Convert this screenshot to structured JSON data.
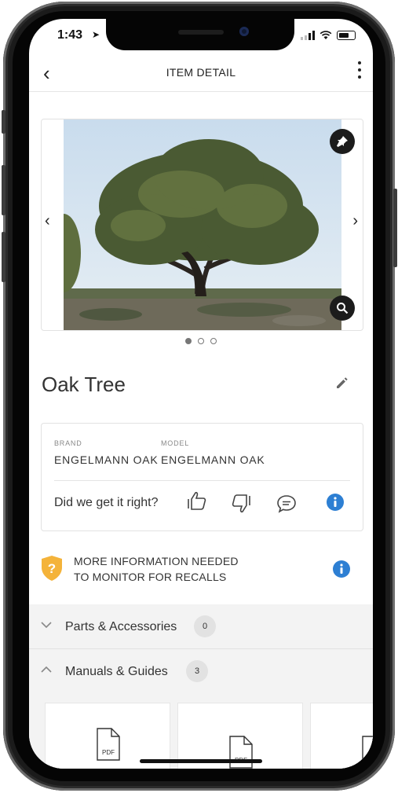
{
  "status": {
    "time": "1:43"
  },
  "navbar": {
    "title": "ITEM DETAIL"
  },
  "gallery": {
    "page_count": 3,
    "active_index": 0
  },
  "item": {
    "title": "Oak Tree"
  },
  "specs": {
    "brand_label": "BRAND",
    "brand_value": "ENGELMANN OAK",
    "model_label": "MODEL",
    "model_value": "ENGELMANN OAK"
  },
  "feedback": {
    "question": "Did we get it right?"
  },
  "recall": {
    "line1": "MORE INFORMATION NEEDED",
    "line2": "TO MONITOR FOR RECALLS"
  },
  "sections": [
    {
      "label": "Parts & Accessories",
      "count": "0",
      "expanded": false
    },
    {
      "label": "Manuals & Guides",
      "count": "3",
      "expanded": true
    }
  ],
  "documents": [
    {
      "type": "PDF"
    },
    {
      "type": "PDF"
    },
    {
      "type": "PDF"
    }
  ],
  "colors": {
    "accent_blue": "#2d7fd3",
    "warning_yellow": "#f4b33a",
    "icon_dark": "#1c1c1c"
  }
}
